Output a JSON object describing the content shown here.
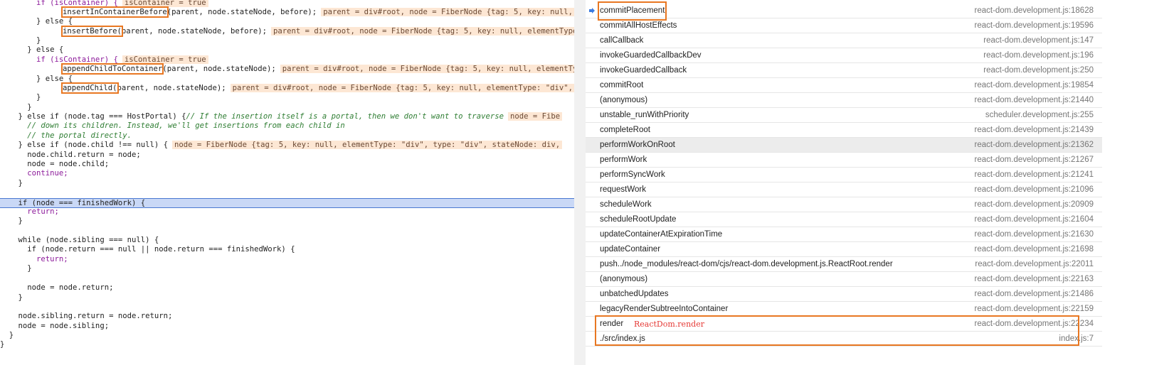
{
  "code": {
    "l0": {
      "a": "        if (isContainer) {",
      "inl": "isContainer = true"
    },
    "l1": {
      "fn": "insertInContainerBefore",
      "rest": "(parent, node.stateNode, before);",
      "inl": "parent = div#root, node = FiberNode {tag: 5, key: null, elementType"
    },
    "l2": "        } else {",
    "l3": {
      "fn": "insertBefore(",
      "rest": "parent, node.stateNode, before);",
      "inl": "parent = div#root, node = FiberNode {tag: 5, key: null, elementType"
    },
    "l4": "        }",
    "l5": "      } else {",
    "l6": {
      "a": "        if (isContainer) {",
      "inl": "isContainer = true"
    },
    "l7": {
      "fn": "appendChildToContainer",
      "rest": "(parent, node.stateNode);",
      "inl": "parent = div#root, node = FiberNode {tag: 5, key: null, elementType"
    },
    "l8": "        } else {",
    "l9": {
      "fn": "appendChild(",
      "rest": "parent, node.stateNode);",
      "inl": "parent = div#root, node = FiberNode {tag: 5, key: null, elementType: \"div\","
    },
    "l10": "        }",
    "l11": "      }",
    "l12": {
      "a": "    } else if (node.tag === HostPortal) {",
      "cm": "// If the insertion itself is a portal, then we don't want to traverse",
      "inl": "node = Fibe"
    },
    "l13": "      // down its children. Instead, we'll get insertions from each child in",
    "l14": "      // the portal directly.",
    "l15": {
      "a": "    } else if (node.child !== null) {",
      "inl": "node = FiberNode {tag: 5, key: null, elementType: \"div\", type: \"div\", stateNode: div,"
    },
    "l16": "      node.child.return = node;",
    "l17": "      node = node.child;",
    "l18": "      continue;",
    "l19": "    }",
    "l20": "    if (node === finishedWork) {",
    "l21": "      return;",
    "l22": "    }",
    "l23": "    while (node.sibling === null) {",
    "l24": "      if (node.return === null || node.return === finishedWork) {",
    "l25": "        return;",
    "l26": "      }",
    "l27": "      node = node.return;",
    "l28": "    }",
    "l29": "    node.sibling.return = node.return;",
    "l30": "    node = node.sibling;",
    "l31": "  }",
    "l32": "}"
  },
  "call_stack": {
    "frames": [
      {
        "name": "commitPlacement",
        "loc": "react-dom.development.js:18628"
      },
      {
        "name": "commitAllHostEffects",
        "loc": "react-dom.development.js:19596"
      },
      {
        "name": "callCallback",
        "loc": "react-dom.development.js:147"
      },
      {
        "name": "invokeGuardedCallbackDev",
        "loc": "react-dom.development.js:196"
      },
      {
        "name": "invokeGuardedCallback",
        "loc": "react-dom.development.js:250"
      },
      {
        "name": "commitRoot",
        "loc": "react-dom.development.js:19854"
      },
      {
        "name": "(anonymous)",
        "loc": "react-dom.development.js:21440"
      },
      {
        "name": "unstable_runWithPriority",
        "loc": "scheduler.development.js:255"
      },
      {
        "name": "completeRoot",
        "loc": "react-dom.development.js:21439"
      },
      {
        "name": "performWorkOnRoot",
        "loc": "react-dom.development.js:21362"
      },
      {
        "name": "performWork",
        "loc": "react-dom.development.js:21267"
      },
      {
        "name": "performSyncWork",
        "loc": "react-dom.development.js:21241"
      },
      {
        "name": "requestWork",
        "loc": "react-dom.development.js:21096"
      },
      {
        "name": "scheduleWork",
        "loc": "react-dom.development.js:20909"
      },
      {
        "name": "scheduleRootUpdate",
        "loc": "react-dom.development.js:21604"
      },
      {
        "name": "updateContainerAtExpirationTime",
        "loc": "react-dom.development.js:21630"
      },
      {
        "name": "updateContainer",
        "loc": "react-dom.development.js:21698"
      },
      {
        "name": "push../node_modules/react-dom/cjs/react-dom.development.js.ReactRoot.render",
        "loc": "react-dom.development.js:22011"
      },
      {
        "name": "(anonymous)",
        "loc": "react-dom.development.js:22163"
      },
      {
        "name": "unbatchedUpdates",
        "loc": "react-dom.development.js:21486"
      },
      {
        "name": "legacyRenderSubtreeIntoContainer",
        "loc": "react-dom.development.js:22159"
      },
      {
        "name": "render",
        "loc": "react-dom.development.js:22234",
        "annot": "ReactDom.render"
      },
      {
        "name": "./src/index.js",
        "loc": "index.js:7"
      }
    ]
  },
  "colors": {
    "highlight": "#e87722",
    "annotation": "#e53935",
    "selected_row": "#ececec"
  },
  "icons": {
    "current_frame": "arrow-right-icon"
  }
}
